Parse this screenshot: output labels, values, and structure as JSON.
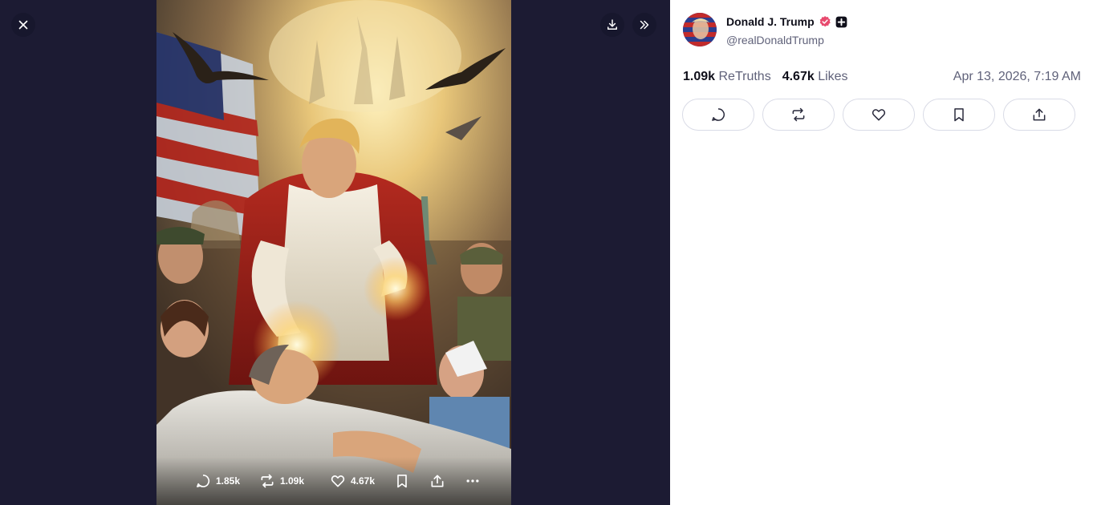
{
  "viewer": {
    "close_icon": "close-icon",
    "download_icon": "download-icon",
    "expand_icon": "double-chevron-right-icon",
    "image_icon": "painting-image",
    "overlay": {
      "replies": "1.85k",
      "retruths": "1.09k",
      "likes": "4.67k",
      "icons": [
        "comment-icon",
        "retruth-icon",
        "heart-icon",
        "bookmark-icon",
        "share-icon",
        "more-icon"
      ]
    }
  },
  "post": {
    "author_name": "Donald J. Trump",
    "author_handle": "@realDonaldTrump",
    "retruths_count": "1.09k",
    "retruths_label": "ReTruths",
    "likes_count": "4.67k",
    "likes_label": "Likes",
    "timestamp": "Apr 13, 2026, 7:19 AM",
    "action_icons": [
      "comment-icon",
      "retruth-icon",
      "heart-icon",
      "bookmark-icon",
      "share-icon"
    ]
  },
  "colors": {
    "viewer_bg": "#1c1b33",
    "verified_badge": "#e84a6e",
    "text_primary": "#0f0f1a",
    "text_secondary": "#60627a",
    "button_border": "#d9dbe6"
  }
}
